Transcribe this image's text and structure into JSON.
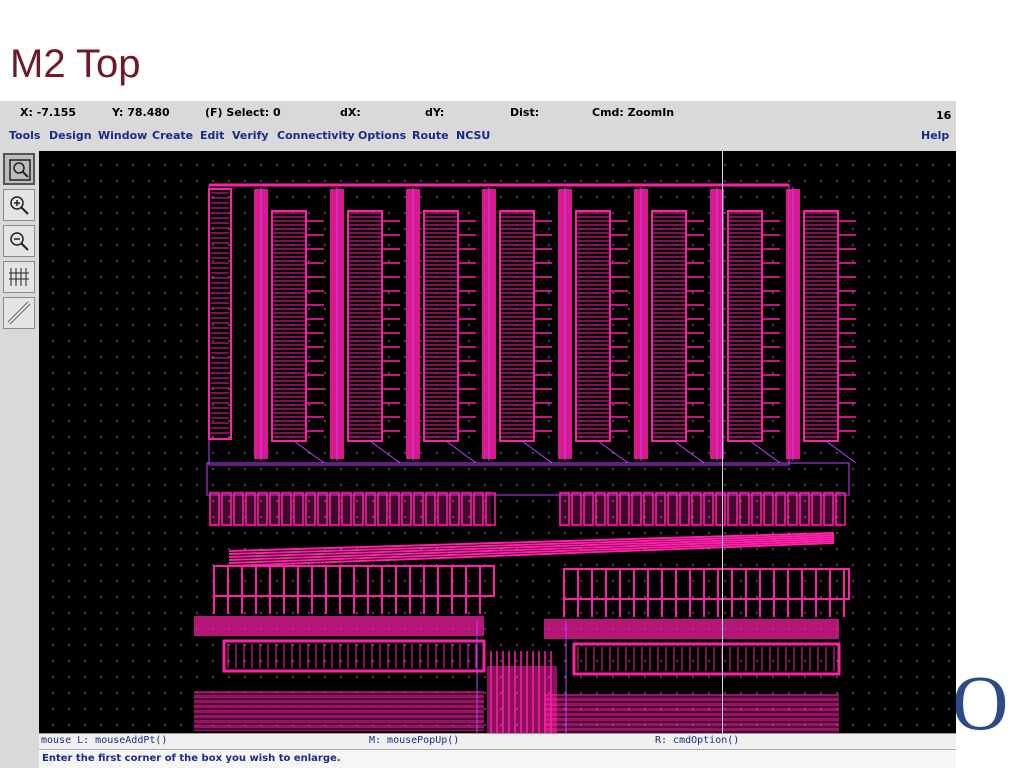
{
  "slide": {
    "title": "M2 Top",
    "logo_letter": "O"
  },
  "status": {
    "x": "X: -7.155",
    "y": "Y: 78.480",
    "select": "(F) Select: 0",
    "dx": "dX:",
    "dy": "dY:",
    "dist": "Dist:",
    "cmd": "Cmd: ZoomIn",
    "count": "16"
  },
  "menu": [
    "Tools",
    "Design",
    "Window",
    "Create",
    "Edit",
    "Verify",
    "Connectivity",
    "Options",
    "Route",
    "NCSU"
  ],
  "help": "Help",
  "toolbar": [
    "zoom-fit-icon",
    "zoom-in-icon",
    "zoom-out-icon",
    "stretch-icon",
    "ruler-icon"
  ],
  "mouse": {
    "left": "mouse L: mouseAddPt()",
    "middle": "M: mousePopUp()",
    "right": "R: cmdOption()"
  },
  "prompt": "Enter the first corner of the box you wish to enlarge.",
  "colors": {
    "layout": "#ff1fa8",
    "wire": "#c040ff",
    "title": "#6e1a2a",
    "menu": "#1a2a8a"
  }
}
